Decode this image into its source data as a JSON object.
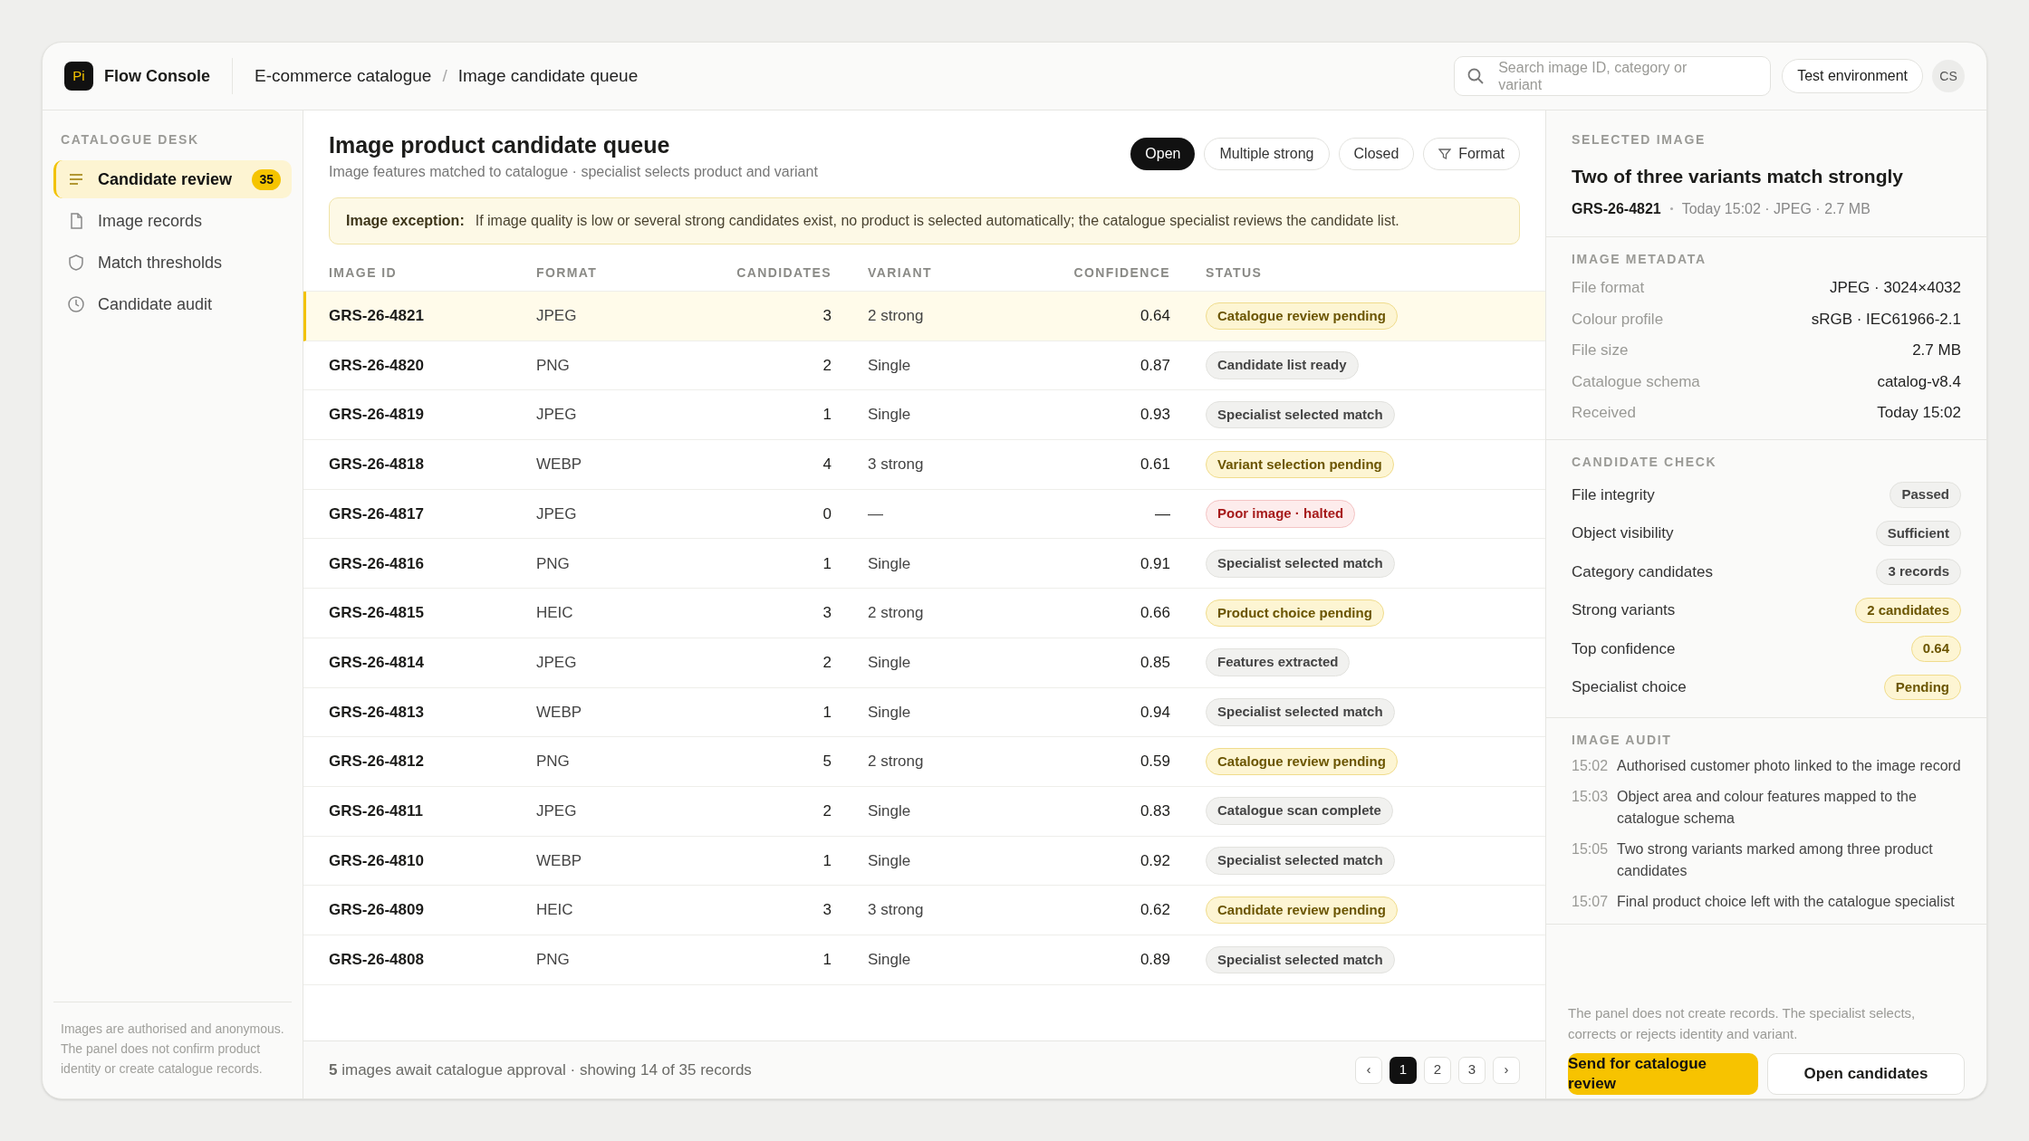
{
  "app": {
    "logo": "Pi",
    "name": "Flow Console"
  },
  "breadcrumb": [
    "E-commerce catalogue",
    "Image candidate queue"
  ],
  "breadcrumb_separator": "/",
  "search": {
    "placeholder": "Search image ID, category or variant"
  },
  "environment": "Test environment",
  "user_initials": "CS",
  "sidebar": {
    "heading": "CATALOGUE DESK",
    "items": [
      {
        "label": "Candidate review",
        "selected": true,
        "badge": "35"
      },
      {
        "label": "Image records",
        "selected": false
      },
      {
        "label": "Match thresholds",
        "selected": false
      },
      {
        "label": "Candidate audit",
        "selected": false
      }
    ],
    "note": "Images are authorised and anonymous. The panel does not confirm product identity or create catalogue records."
  },
  "queue": {
    "title": "Image product candidate queue",
    "subtitle": "Image features matched to catalogue · specialist selects product and variant",
    "filters": [
      {
        "label": "Open",
        "selected": true
      },
      {
        "label": "Multiple strong",
        "selected": false
      },
      {
        "label": "Closed",
        "selected": false
      },
      {
        "label": "Format",
        "selected": false,
        "kind": "filter"
      }
    ],
    "alert": {
      "title": "Image exception:",
      "text": "If image quality is low or several strong candidates exist, no product is selected automatically; the catalogue specialist reviews the candidate list."
    },
    "columns": [
      "IMAGE ID",
      "FORMAT",
      "CANDIDATES",
      "VARIANT",
      "CONFIDENCE",
      "STATUS"
    ],
    "rows": [
      {
        "id": "GRS-26-4821",
        "format": "JPEG",
        "candidates": "3",
        "variant": "2 strong",
        "confidence": "0.64",
        "status": "Catalogue review pending",
        "kind": "warning",
        "selected": true
      },
      {
        "id": "GRS-26-4820",
        "format": "PNG",
        "candidates": "2",
        "variant": "Single",
        "confidence": "0.87",
        "status": "Candidate list ready",
        "kind": "neutral",
        "selected": false
      },
      {
        "id": "GRS-26-4819",
        "format": "JPEG",
        "candidates": "1",
        "variant": "Single",
        "confidence": "0.93",
        "status": "Specialist selected match",
        "kind": "neutral",
        "selected": false
      },
      {
        "id": "GRS-26-4818",
        "format": "WEBP",
        "candidates": "4",
        "variant": "3 strong",
        "confidence": "0.61",
        "status": "Variant selection pending",
        "kind": "warning",
        "selected": false
      },
      {
        "id": "GRS-26-4817",
        "format": "JPEG",
        "candidates": "0",
        "variant": "—",
        "confidence": "—",
        "status": "Poor image · halted",
        "kind": "danger",
        "selected": false
      },
      {
        "id": "GRS-26-4816",
        "format": "PNG",
        "candidates": "1",
        "variant": "Single",
        "confidence": "0.91",
        "status": "Specialist selected match",
        "kind": "neutral",
        "selected": false
      },
      {
        "id": "GRS-26-4815",
        "format": "HEIC",
        "candidates": "3",
        "variant": "2 strong",
        "confidence": "0.66",
        "status": "Product choice pending",
        "kind": "warning",
        "selected": false
      },
      {
        "id": "GRS-26-4814",
        "format": "JPEG",
        "candidates": "2",
        "variant": "Single",
        "confidence": "0.85",
        "status": "Features extracted",
        "kind": "neutral",
        "selected": false
      },
      {
        "id": "GRS-26-4813",
        "format": "WEBP",
        "candidates": "1",
        "variant": "Single",
        "confidence": "0.94",
        "status": "Specialist selected match",
        "kind": "neutral",
        "selected": false
      },
      {
        "id": "GRS-26-4812",
        "format": "PNG",
        "candidates": "5",
        "variant": "2 strong",
        "confidence": "0.59",
        "status": "Catalogue review pending",
        "kind": "warning",
        "selected": false
      },
      {
        "id": "GRS-26-4811",
        "format": "JPEG",
        "candidates": "2",
        "variant": "Single",
        "confidence": "0.83",
        "status": "Catalogue scan complete",
        "kind": "neutral",
        "selected": false
      },
      {
        "id": "GRS-26-4810",
        "format": "WEBP",
        "candidates": "1",
        "variant": "Single",
        "confidence": "0.92",
        "status": "Specialist selected match",
        "kind": "neutral",
        "selected": false
      },
      {
        "id": "GRS-26-4809",
        "format": "HEIC",
        "candidates": "3",
        "variant": "3 strong",
        "confidence": "0.62",
        "status": "Candidate review pending",
        "kind": "warning",
        "selected": false
      },
      {
        "id": "GRS-26-4808",
        "format": "PNG",
        "candidates": "1",
        "variant": "Single",
        "confidence": "0.89",
        "status": "Specialist selected match",
        "kind": "neutral",
        "selected": false
      }
    ],
    "footer": "**5** images await catalogue approval · showing 14 of 35 records",
    "pagination": [
      {
        "label": "‹",
        "selected": false
      },
      {
        "label": "1",
        "selected": true
      },
      {
        "label": "2",
        "selected": false
      },
      {
        "label": "3",
        "selected": false
      },
      {
        "label": "›",
        "selected": false
      }
    ]
  },
  "detail": {
    "heading": "SELECTED IMAGE",
    "title": "Two of three variants match strongly",
    "image_id": "GRS-26-4821",
    "meta_line": "Today 15:02 · JPEG · 2.7 MB",
    "metadata_heading": "IMAGE METADATA",
    "metadata": [
      {
        "label": "File format",
        "value": "JPEG · 3024×4032"
      },
      {
        "label": "Colour profile",
        "value": "sRGB · IEC61966-2.1"
      },
      {
        "label": "File size",
        "value": "2.7 MB"
      },
      {
        "label": "Catalogue schema",
        "value": "catalog-v8.4"
      },
      {
        "label": "Received",
        "value": "Today 15:02"
      }
    ],
    "check_heading": "CANDIDATE CHECK",
    "checks": [
      {
        "label": "File integrity",
        "value": "Passed",
        "kind": "neutral"
      },
      {
        "label": "Object visibility",
        "value": "Sufficient",
        "kind": "neutral"
      },
      {
        "label": "Category candidates",
        "value": "3 records",
        "kind": "neutral"
      },
      {
        "label": "Strong variants",
        "value": "2 candidates",
        "kind": "warning"
      },
      {
        "label": "Top confidence",
        "value": "0.64",
        "kind": "warning"
      },
      {
        "label": "Specialist choice",
        "value": "Pending",
        "kind": "warning"
      }
    ],
    "audit_heading": "IMAGE AUDIT",
    "audit": [
      {
        "time": "15:02",
        "text": "Authorised customer photo linked to the image record"
      },
      {
        "time": "15:03",
        "text": "Object area and colour features mapped to the catalogue schema"
      },
      {
        "time": "15:05",
        "text": "Two strong variants marked among three product candidates"
      },
      {
        "time": "15:07",
        "text": "Final product choice left with the catalogue specialist"
      }
    ],
    "note": "The panel does not create records. The specialist selects, corrects or rejects identity and variant.",
    "primary_button": "Send for catalogue review",
    "secondary_button": "Open candidates"
  }
}
